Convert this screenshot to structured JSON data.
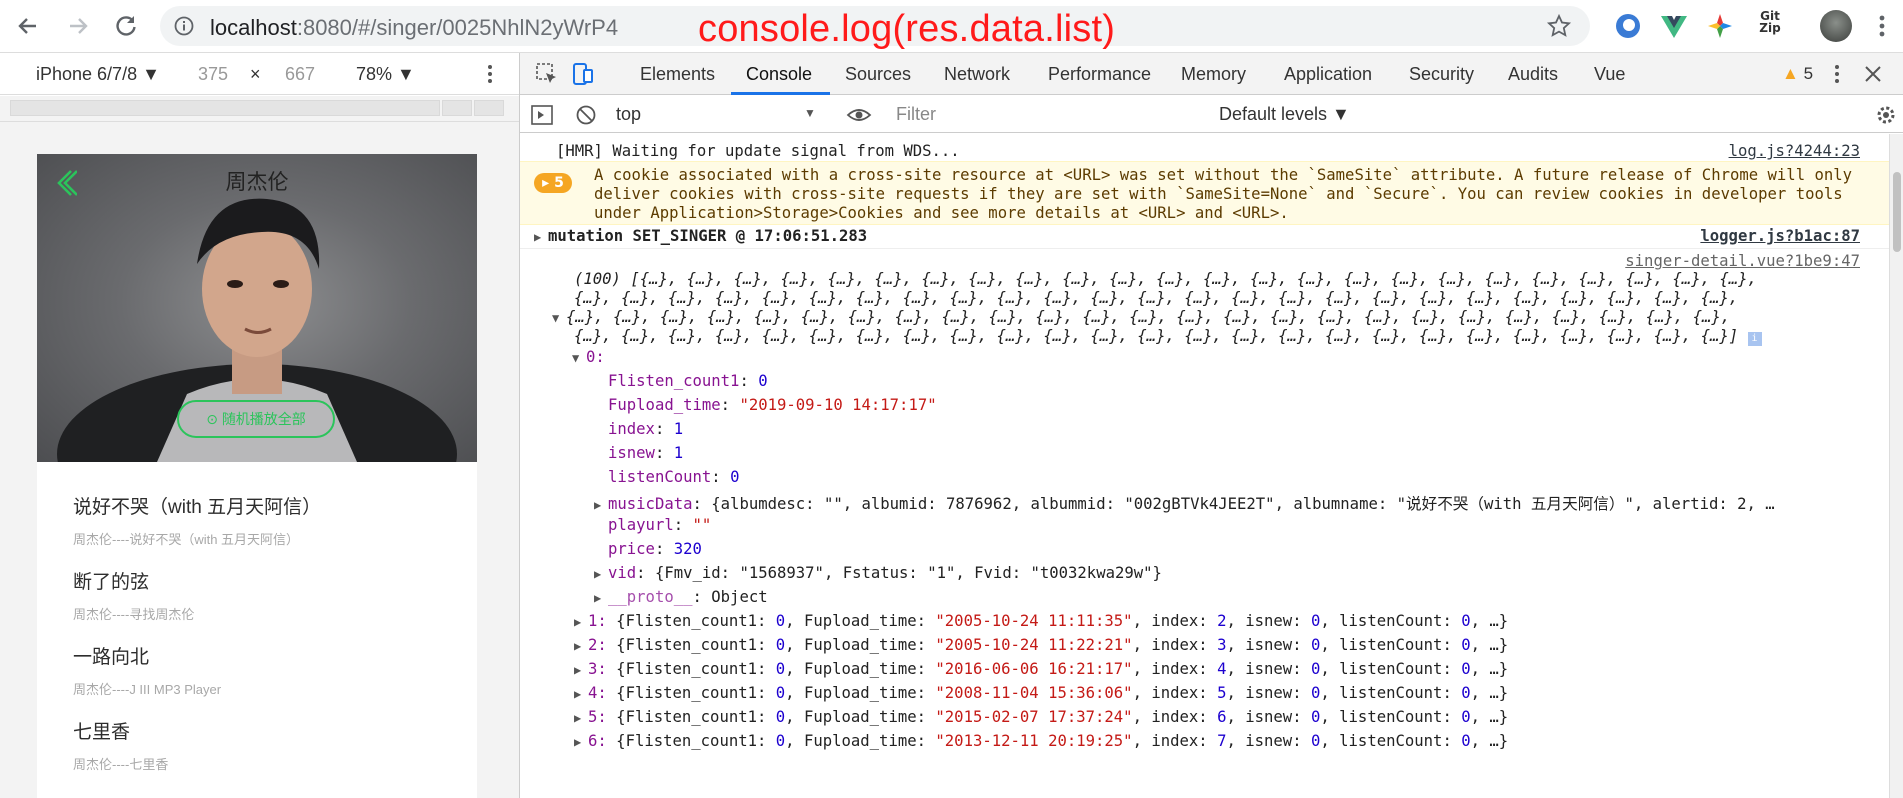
{
  "browser": {
    "url_host": "localhost",
    "url_rest": ":8080/#/singer/0025NhlN2yWrP4"
  },
  "annotation": "console.log(res.data.list)",
  "device_toolbar": {
    "device": "iPhone 6/7/8 ▼",
    "width": "375",
    "x": "×",
    "height": "667",
    "zoom": "78% ▼"
  },
  "phone": {
    "singer_name": "周杰伦",
    "play_button": "随机播放全部",
    "songs": [
      {
        "title": "说好不哭（with 五月天阿信）",
        "subtitle": "周杰伦----说好不哭（with 五月天阿信）"
      },
      {
        "title": "断了的弦",
        "subtitle": "周杰伦----寻找周杰伦"
      },
      {
        "title": "一路向北",
        "subtitle": "周杰伦----J III MP3 Player"
      },
      {
        "title": "七里香",
        "subtitle": "周杰伦----七里香"
      }
    ]
  },
  "devtools": {
    "tabs": [
      "Elements",
      "Console",
      "Sources",
      "Network",
      "Performance",
      "Memory",
      "Application",
      "Security",
      "Audits",
      "Vue"
    ],
    "active_tab": "Console",
    "warning_count": "5",
    "context": "top",
    "filter_placeholder": "Filter",
    "levels": "Default levels ▼"
  },
  "console": {
    "hmr": "[HMR] Waiting for update signal from WDS...",
    "hmr_src": "log.js?4244:23",
    "warn_count": "5",
    "warn_text": "A cookie associated with a cross-site resource at <URL> was set without the `SameSite` attribute. A future release of Chrome will only deliver cookies with cross-site requests if they are set with `SameSite=None` and `Secure`. You can review cookies in developer tools under Application>Storage>Cookies and see more details at <URL> and <URL>.",
    "mutation": "mutation SET_SINGER @ 17:06:51.283",
    "mutation_src": "logger.js?b1ac:87",
    "array_src": "singer-detail.vue?1be9:47",
    "array_line1": "(100) [{…}, {…}, {…}, {…}, {…}, {…}, {…}, {…}, {…}, {…}, {…}, {…}, {…}, {…}, {…}, {…}, {…}, {…}, {…}, {…}, {…}, {…}, {…}, {…},",
    "array_line2": "{…}, {…}, {…}, {…}, {…}, {…}, {…}, {…}, {…}, {…}, {…}, {…}, {…}, {…}, {…}, {…}, {…}, {…}, {…}, {…}, {…}, {…}, {…}, {…}, {…},",
    "array_line3": "{…}, {…}, {…}, {…}, {…}, {…}, {…}, {…}, {…}, {…}, {…}, {…}, {…}, {…}, {…}, {…}, {…}, {…}, {…}, {…}, {…}, {…}, {…}, {…}, {…},",
    "array_line4": "{…}, {…}, {…}, {…}, {…}, {…}, {…}, {…}, {…}, {…}, {…}, {…}, {…}, {…}, {…}, {…}, {…}, {…}, {…}, {…}, {…}, {…}, {…}, {…}, {…}]",
    "item0_key": "0:",
    "item0": [
      {
        "k": "Flisten_count1",
        "v": "0",
        "type": "num"
      },
      {
        "k": "Fupload_time",
        "v": "\"2019-09-10 14:17:17\"",
        "type": "str"
      },
      {
        "k": "index",
        "v": "1",
        "type": "num"
      },
      {
        "k": "isnew",
        "v": "1",
        "type": "num"
      },
      {
        "k": "listenCount",
        "v": "0",
        "type": "num"
      }
    ],
    "musicData_key": "musicData",
    "musicData_val": "{albumdesc: \"\", albumid: 7876962, albummid: \"002gBTVk4JEE2T\", albumname: \"说好不哭（with 五月天阿信）\", alertid: 2, …",
    "playurl_key": "playurl",
    "playurl_val": "\"\"",
    "price_key": "price",
    "price_val": "320",
    "vid_key": "vid",
    "vid_val": "{Fmv_id: \"1568937\", Fstatus: \"1\", Fvid: \"t0032kwa29w\"}",
    "proto_key": "__proto__",
    "proto_val": "Object",
    "rows": [
      {
        "i": "1:",
        "time": "\"2005-10-24 11:11:35\"",
        "index": "2"
      },
      {
        "i": "2:",
        "time": "\"2005-10-24 11:22:21\"",
        "index": "3"
      },
      {
        "i": "3:",
        "time": "\"2016-06-06 16:21:17\"",
        "index": "4"
      },
      {
        "i": "4:",
        "time": "\"2008-11-04 15:36:06\"",
        "index": "5"
      },
      {
        "i": "5:",
        "time": "\"2015-02-07 17:37:24\"",
        "index": "6"
      },
      {
        "i": "6:",
        "time": "\"2013-12-11 20:19:25\"",
        "index": "7"
      }
    ]
  }
}
